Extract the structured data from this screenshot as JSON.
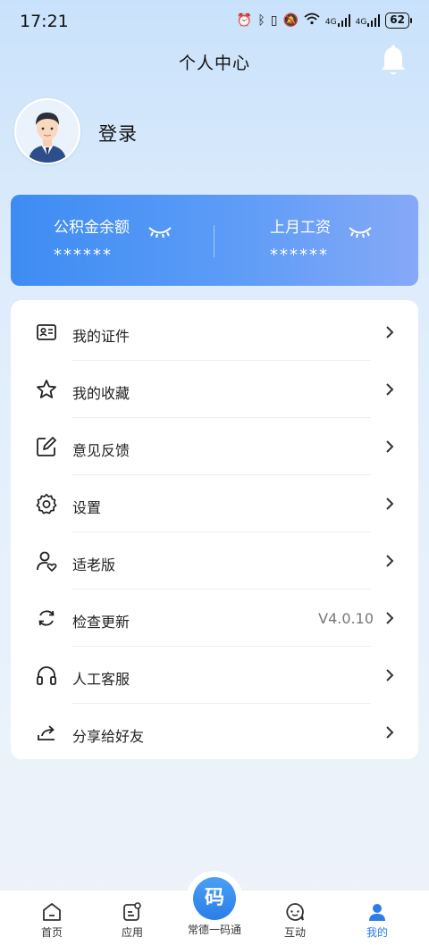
{
  "status_bar": {
    "time": "17:21",
    "icons": [
      "alarm-icon",
      "bluetooth-icon",
      "vibrate-icon",
      "mute-icon",
      "wifi-icon",
      "signal-4g-icon",
      "signal-4g-icon"
    ],
    "net1": "4G",
    "net2": "4G",
    "battery": "62"
  },
  "header": {
    "title": "个人中心"
  },
  "profile": {
    "login_label": "登录"
  },
  "finance": {
    "left_label": "公积金余额",
    "left_value": "******",
    "right_label": "上月工资",
    "right_value": "******"
  },
  "menu": {
    "items": [
      {
        "label": "我的证件",
        "icon": "id-card-icon",
        "value": ""
      },
      {
        "label": "我的收藏",
        "icon": "star-icon",
        "value": ""
      },
      {
        "label": "意见反馈",
        "icon": "edit-icon",
        "value": ""
      },
      {
        "label": "设置",
        "icon": "gear-icon",
        "value": ""
      },
      {
        "label": "适老版",
        "icon": "elder-user-icon",
        "value": ""
      },
      {
        "label": "检查更新",
        "icon": "refresh-icon",
        "value": "V4.0.10"
      },
      {
        "label": "人工客服",
        "icon": "headset-icon",
        "value": ""
      },
      {
        "label": "分享给好友",
        "icon": "share-icon",
        "value": ""
      }
    ]
  },
  "bottom_nav": {
    "items": [
      {
        "label": "首页",
        "icon": "home-icon"
      },
      {
        "label": "应用",
        "icon": "apps-icon"
      },
      {
        "label": "常德一码通",
        "icon": "qr-code-icon",
        "badge": "码"
      },
      {
        "label": "互动",
        "icon": "chat-icon"
      },
      {
        "label": "我的",
        "icon": "user-icon"
      }
    ],
    "active_color": "#2b7de9"
  },
  "colors": {
    "accent": "#2b7de9",
    "card_gradient_start": "#3d8cf3",
    "card_gradient_end": "#86a9f7"
  }
}
